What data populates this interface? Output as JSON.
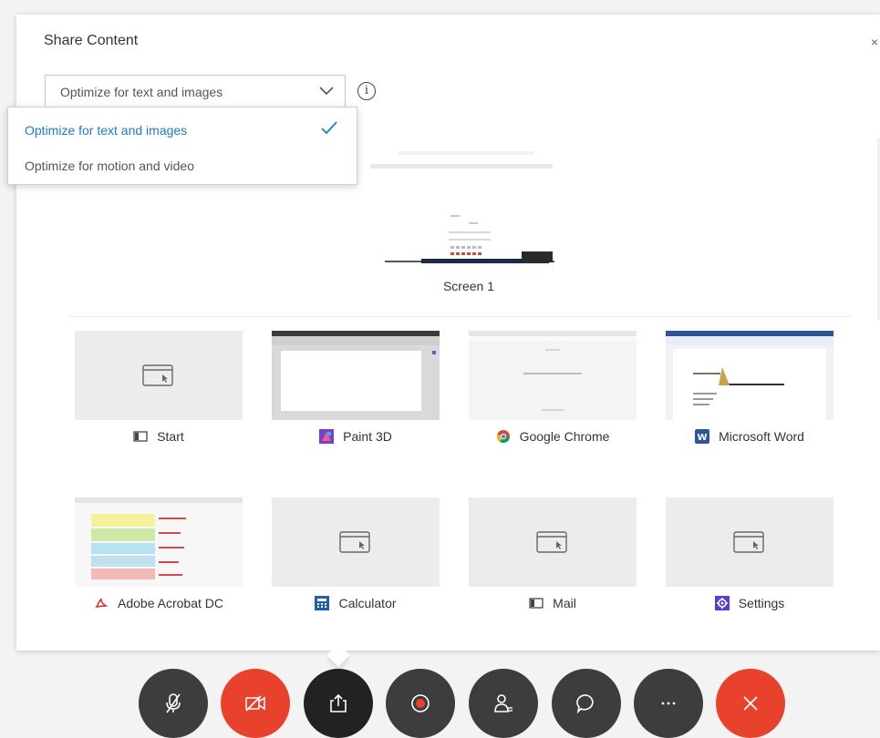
{
  "dialog": {
    "title": "Share Content",
    "close_glyph": "×"
  },
  "optimize": {
    "selected_value": "Optimize for text and images",
    "options": [
      {
        "label": "Optimize for text and images",
        "selected": true
      },
      {
        "label": "Optimize for motion and video",
        "selected": false
      }
    ],
    "info_glyph": "i"
  },
  "screens": [
    {
      "label": "Screen 1"
    }
  ],
  "windows": [
    {
      "label": "Start",
      "icon": "start-window-icon",
      "has_preview": false
    },
    {
      "label": "Paint 3D",
      "icon": "paint-3d-icon",
      "has_preview": true
    },
    {
      "label": "Google Chrome",
      "icon": "chrome-icon",
      "has_preview": true
    },
    {
      "label": "Microsoft Word",
      "icon": "word-icon",
      "has_preview": true
    },
    {
      "label": "Adobe Acrobat DC",
      "icon": "acrobat-icon",
      "has_preview": true
    },
    {
      "label": "Calculator",
      "icon": "calculator-icon",
      "has_preview": false
    },
    {
      "label": "Mail",
      "icon": "mail-icon",
      "has_preview": false
    },
    {
      "label": "Settings",
      "icon": "settings-icon",
      "has_preview": false
    }
  ],
  "toolbar": {
    "buttons": [
      {
        "name": "mute-microphone-button",
        "icon": "microphone-muted-icon",
        "color": "#3d3d3d"
      },
      {
        "name": "stop-video-button",
        "icon": "video-off-icon",
        "color": "#e8412c"
      },
      {
        "name": "share-content-button",
        "icon": "share-icon",
        "color": "#222222"
      },
      {
        "name": "record-button",
        "icon": "record-icon",
        "color": "#3d3d3d"
      },
      {
        "name": "participants-button",
        "icon": "participants-icon",
        "color": "#3d3d3d"
      },
      {
        "name": "chat-button",
        "icon": "chat-icon",
        "color": "#3d3d3d"
      },
      {
        "name": "more-options-button",
        "icon": "more-icon",
        "color": "#3d3d3d"
      },
      {
        "name": "leave-meeting-button",
        "icon": "close-icon",
        "color": "#e8412c"
      }
    ]
  },
  "colors": {
    "accent": "#1f7bc6",
    "danger": "#e8412c",
    "control": "#3d3d3d"
  }
}
